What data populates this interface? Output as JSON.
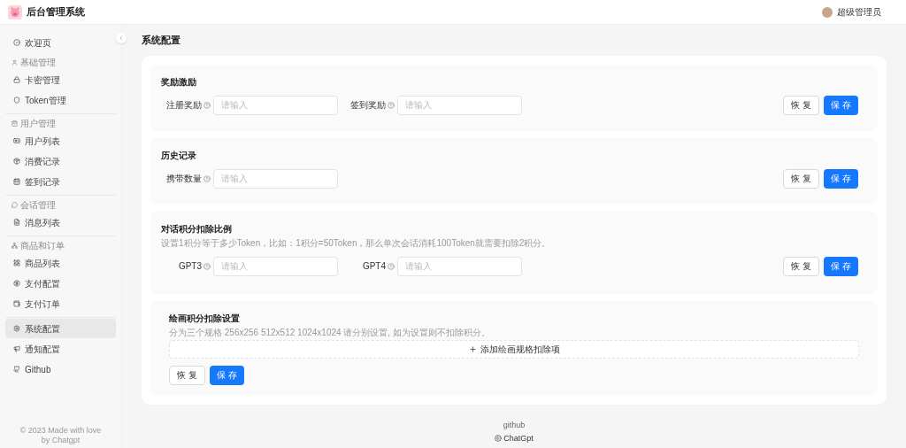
{
  "app_title": "后台管理系统",
  "user": {
    "name": "超级管理员"
  },
  "sidebar": {
    "sections": [
      {
        "items": [
          {
            "label": "欢迎页",
            "selected": false
          }
        ]
      },
      {
        "title": "基础管理",
        "items": [
          {
            "label": "卡密管理",
            "selected": false
          },
          {
            "label": "Token管理",
            "selected": false
          }
        ]
      },
      {
        "title": "用户管理",
        "items": [
          {
            "label": "用户列表",
            "selected": false
          },
          {
            "label": "消费记录",
            "selected": false
          },
          {
            "label": "签到记录",
            "selected": false
          }
        ]
      },
      {
        "title": "会话管理",
        "items": [
          {
            "label": "消息列表",
            "selected": false
          }
        ]
      },
      {
        "title": "商品和订单",
        "items": [
          {
            "label": "商品列表",
            "selected": false
          },
          {
            "label": "支付配置",
            "selected": false
          },
          {
            "label": "支付订单",
            "selected": false
          }
        ]
      },
      {
        "items": [
          {
            "label": "系统配置",
            "selected": true
          },
          {
            "label": "通知配置",
            "selected": false
          },
          {
            "label": "Github",
            "selected": false
          }
        ]
      }
    ],
    "footer": [
      "© 2023 Made with love",
      "by Chatgpt"
    ]
  },
  "page_title": "系统配置",
  "sections": [
    {
      "kind": "fields",
      "title": "奖励激励",
      "fields": [
        {
          "label": "注册奖励",
          "placeholder": "请输入"
        },
        {
          "label": "签到奖励",
          "placeholder": "请输入"
        }
      ],
      "buttons": [
        "恢 复",
        "保 存"
      ]
    },
    {
      "kind": "fields",
      "title": "历史记录",
      "fields": [
        {
          "label": "携带数量",
          "placeholder": "请输入"
        }
      ],
      "buttons": [
        "恢 复",
        "保 存"
      ]
    },
    {
      "kind": "fields",
      "title": "对话积分扣除比例",
      "description": "设置1积分等于多少Token，比如：1积分=50Token，那么单次会话消耗100Token就需要扣除2积分。",
      "fields": [
        {
          "label": "GPT3",
          "placeholder": "请输入"
        },
        {
          "label": "GPT4",
          "placeholder": "请输入"
        }
      ],
      "buttons": [
        "恢 复",
        "保 存"
      ]
    },
    {
      "kind": "list",
      "title": "绘画积分扣除设置",
      "description": "分为三个规格 256x256 512x512 1024x1024 请分别设置, 如为设置则不扣除积分。",
      "add_label": "添加绘画规格扣除项",
      "buttons": [
        "恢 复",
        "保 存"
      ]
    }
  ],
  "footer": {
    "link": "github",
    "copyright": "ChatGpt"
  }
}
